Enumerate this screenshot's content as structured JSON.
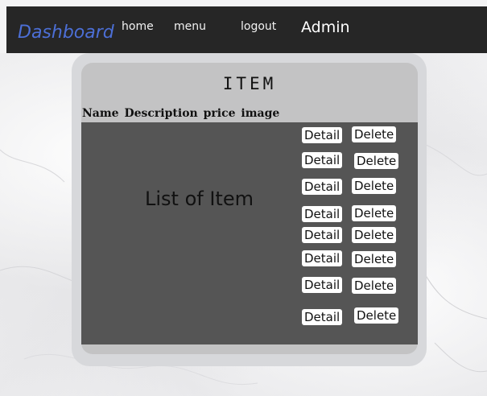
{
  "header": {
    "brand": "Dashboard",
    "nav": [
      "home",
      "menu",
      "logout"
    ],
    "user": "Admin"
  },
  "panel": {
    "title": "ITEM",
    "columns": [
      "Name",
      "Description",
      "price",
      "image"
    ],
    "list_title": "List of Item"
  },
  "rows": [
    {
      "detail": "Detail",
      "delete": "Delete"
    },
    {
      "detail": "Detail",
      "delete": "Delete"
    },
    {
      "detail": "Detail",
      "delete": "Delete"
    },
    {
      "detail": "Detail",
      "delete": "Delete"
    },
    {
      "detail": "Detail",
      "delete": "Delete"
    },
    {
      "detail": "Detail",
      "delete": "Delete"
    },
    {
      "detail": "Detail",
      "delete": "Delete"
    },
    {
      "detail": "Detail",
      "delete": "Delete"
    }
  ],
  "colors": {
    "topbar": "#262626",
    "brand": "#4c6fd6",
    "list_panel": "#555555",
    "button_bg": "#ffffff"
  }
}
